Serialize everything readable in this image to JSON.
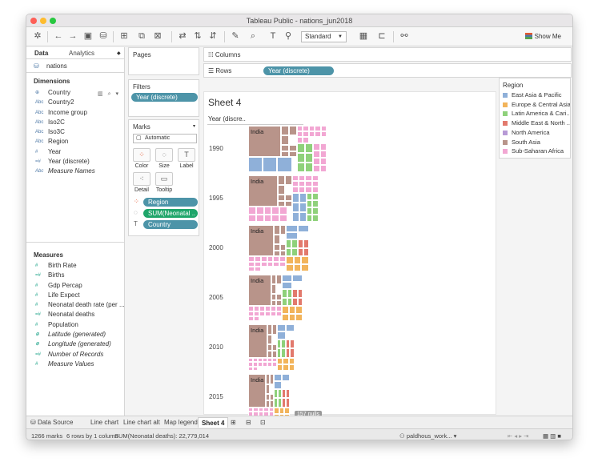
{
  "window": {
    "title": "Tableau Public - nations_jun2018"
  },
  "toolbar": {
    "fit_select": "Standard",
    "show_me": "Show Me"
  },
  "left_pane": {
    "tab_data": "Data",
    "tab_analytics": "Analytics",
    "datasource": "nations",
    "dimensions_header": "Dimensions",
    "measures_header": "Measures",
    "dimensions": [
      {
        "type": "⊕",
        "name": "Country",
        "italic": false
      },
      {
        "type": "Abc",
        "name": "Country2",
        "italic": false
      },
      {
        "type": "Abc",
        "name": "Income group",
        "italic": false
      },
      {
        "type": "Abc",
        "name": "Iso2C",
        "italic": false
      },
      {
        "type": "Abc",
        "name": "Iso3C",
        "italic": false
      },
      {
        "type": "Abc",
        "name": "Region",
        "italic": false
      },
      {
        "type": "#",
        "name": "Year",
        "italic": false
      },
      {
        "type": "=#",
        "name": "Year (discrete)",
        "italic": false
      },
      {
        "type": "Abc",
        "name": "Measure Names",
        "italic": true
      }
    ],
    "measures": [
      {
        "type": "#",
        "name": "Birth Rate",
        "italic": false
      },
      {
        "type": "=#",
        "name": "Births",
        "italic": false
      },
      {
        "type": "#",
        "name": "Gdp Percap",
        "italic": false
      },
      {
        "type": "#",
        "name": "Life Expect",
        "italic": false
      },
      {
        "type": "#",
        "name": "Neonatal death rate (per ...",
        "italic": false
      },
      {
        "type": "=#",
        "name": "Neonatal deaths",
        "italic": false
      },
      {
        "type": "#",
        "name": "Population",
        "italic": false
      },
      {
        "type": "⊕",
        "name": "Latitude (generated)",
        "italic": true
      },
      {
        "type": "⊕",
        "name": "Longitude (generated)",
        "italic": true
      },
      {
        "type": "=#",
        "name": "Number of Records",
        "italic": true
      },
      {
        "type": "#",
        "name": "Measure Values",
        "italic": true
      }
    ]
  },
  "cards": {
    "pages": "Pages",
    "filters": "Filters",
    "filter_pill": "Year (discrete)",
    "marks": "Marks",
    "mark_type": "Automatic",
    "buttons": [
      "Color",
      "Size",
      "Label",
      "Detail",
      "Tooltip"
    ],
    "pill_region": "Region",
    "pill_size": "SUM(Neonatal ..",
    "pill_country": "Country"
  },
  "shelves": {
    "columns_label": "Columns",
    "rows_label": "Rows",
    "rows_pill": "Year (discrete)"
  },
  "viz": {
    "title": "Sheet 4",
    "header": "Year (discre..",
    "years": [
      "1990",
      "1995",
      "2000",
      "2005",
      "2010",
      "2015"
    ],
    "treemap_label": "India",
    "nulls": "157 nulls"
  },
  "legend": {
    "title": "Region",
    "items": [
      {
        "name": "East Asia & Pacific",
        "color": "#8fb0d9"
      },
      {
        "name": "Europe & Central Asia",
        "color": "#f2b45b"
      },
      {
        "name": "Latin America & Cari..",
        "color": "#8fd17b"
      },
      {
        "name": "Middle East & North ..",
        "color": "#e27a6d"
      },
      {
        "name": "North America",
        "color": "#b79ad6"
      },
      {
        "name": "South Asia",
        "color": "#b8948a"
      },
      {
        "name": "Sub-Saharan Africa",
        "color": "#f2a7d3"
      }
    ]
  },
  "bottom_tabs": {
    "data_source": "Data Source",
    "sheets": [
      "Line chart",
      "Line chart alt",
      "Map legend",
      "Sheet 4"
    ]
  },
  "status": {
    "marks": "1266 marks",
    "rows_cols": "6 rows by 1 column",
    "sum": "SUM(Neonatal deaths): 22,779,014",
    "user": "paldhous_work..."
  }
}
